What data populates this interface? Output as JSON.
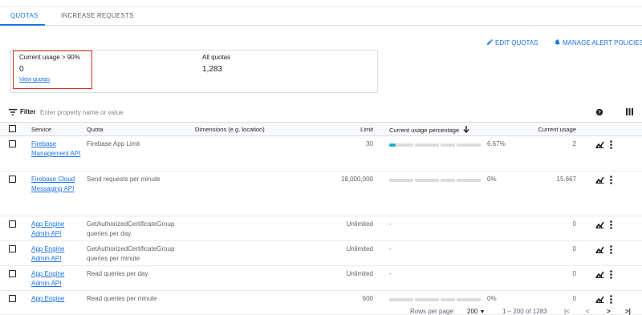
{
  "tabs": [
    {
      "label": "QUOTAS"
    },
    {
      "label": "INCREASE REQUESTS"
    }
  ],
  "actions": {
    "edit_quotas": "EDIT QUOTAS",
    "manage_alert_policies": "MANAGE ALERT POLICIES"
  },
  "summary": {
    "current_usage_label": "Current usage > 90%",
    "current_usage_value": "0",
    "view_quotas_link": "View quotas",
    "all_quotas_label": "All quotas",
    "all_quotas_value": "1,283"
  },
  "filter": {
    "label": "Filter",
    "placeholder": "Enter property name or value"
  },
  "table": {
    "headers": {
      "service": "Service",
      "quota": "Quota",
      "dimensions": "Dimensions (e.g. location)",
      "limit": "Limit",
      "usage_pct": "Current usage percentage",
      "usage": "Current usage"
    },
    "rows": [
      {
        "service": "Firebase Management API",
        "quota": "Firebase App Limit",
        "limit": "30",
        "pct": "6.67%",
        "pct_value": 0.0667,
        "usage": "2"
      },
      {
        "service": "Firebase Cloud Messaging API",
        "quota": "Send requests per minute",
        "limit": "18,000,000",
        "pct": "0%",
        "pct_value": 0,
        "usage": "15.667"
      },
      {
        "service": "App Engine Admin API",
        "quota": "GetAuthorizedCertificateGroup queries per day",
        "limit": "Unlimited",
        "pct": "-",
        "usage": "0"
      },
      {
        "service": "App Engine Admin API",
        "quota": "GetAuthorizedCertificateGroup queries per minute",
        "limit": "Unlimited",
        "pct": "-",
        "usage": "0"
      },
      {
        "service": "App Engine Admin API",
        "quota": "Read queries per day",
        "limit": "Unlimited",
        "pct": "-",
        "usage": "0"
      },
      {
        "service": "App Engine",
        "quota": "Read queries per minute",
        "limit": "600",
        "pct": "0%",
        "pct_value": 0,
        "usage": "0"
      }
    ]
  },
  "footer": {
    "rows_per_page_label": "Rows per page:",
    "rows_per_page_value": "200",
    "range": "1 – 200 of 1283"
  },
  "icons": {
    "pencil": "edit-icon",
    "bell": "alert-bell-icon",
    "filter": "filter-icon",
    "help": "help-icon",
    "columns": "column-display-icon",
    "chart": "monitoring-chart-icon",
    "more": "more-vert-icon"
  },
  "colors": {
    "accent": "#1a73e8",
    "usage_bar": "#12b5cb",
    "highlight_border": "#d93025"
  }
}
